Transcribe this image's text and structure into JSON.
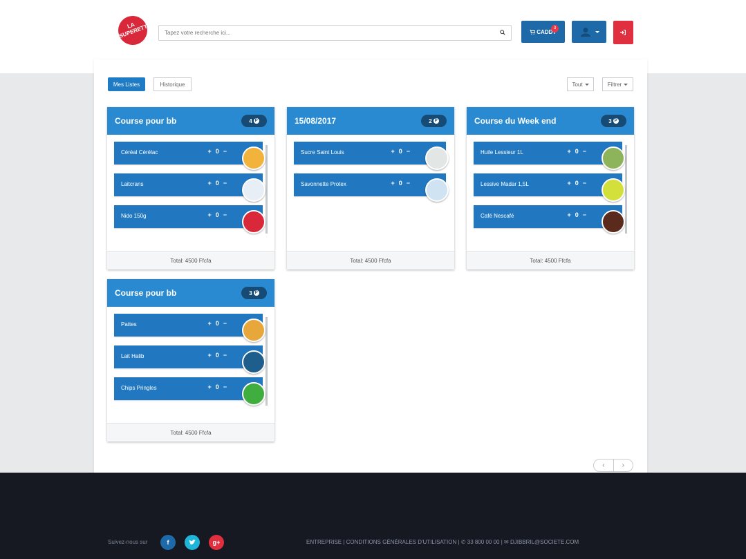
{
  "header": {
    "logo_text": "LA SUPERETTE",
    "search_placeholder": "Tapez votre recherche ici...",
    "caddy_label": "CADDY",
    "caddy_count": "3"
  },
  "tabs": {
    "active": "Mes Listes",
    "inactive": "Historique"
  },
  "filters": {
    "tout": "Tout",
    "filtrer": "Filtrer"
  },
  "lists": [
    {
      "title": "Course pour bb",
      "count": "4",
      "items": [
        {
          "name": "Céréal Cérélac",
          "qty": "0",
          "img_color": "#f2b33d"
        },
        {
          "name": "Laitcrans",
          "qty": "0",
          "img_color": "#e8eef6"
        },
        {
          "name": "Nido 150g",
          "qty": "0",
          "img_color": "#d9283a"
        }
      ],
      "total": "Total: 4500 Ffcfa"
    },
    {
      "title": "15/08/2017",
      "count": "2",
      "items": [
        {
          "name": "Sucre Saint Louis",
          "qty": "0",
          "img_color": "#e2e6e4"
        },
        {
          "name": "Savonnette Protex",
          "qty": "0",
          "img_color": "#cfe3f2"
        }
      ],
      "total": "Total: 4500 Ffcfa"
    },
    {
      "title": "Course du Week end",
      "count": "3",
      "items": [
        {
          "name": "Huile Lessieur 1L",
          "qty": "0",
          "img_color": "#8db45a"
        },
        {
          "name": "Lessive Madar 1,5L",
          "qty": "0",
          "img_color": "#d3df3a"
        },
        {
          "name": "Café Nescafé",
          "qty": "0",
          "img_color": "#5a2a1c"
        }
      ],
      "total": "Total: 4500 Ffcfa"
    },
    {
      "title": "Course pour bb",
      "count": "3",
      "items": [
        {
          "name": "Pattes",
          "qty": "0",
          "img_color": "#e8a73a"
        },
        {
          "name": "Lait Halib",
          "qty": "0",
          "img_color": "#1d5e8c"
        },
        {
          "name": "Chips Pringles",
          "qty": "0",
          "img_color": "#3fae3f"
        }
      ],
      "total": "Total: 4500 Ffcfa"
    }
  ],
  "pager": {
    "prev": "‹",
    "next": "›"
  },
  "footer": {
    "follow": "Suivez-nous sur",
    "entreprise": "ENTREPRISE",
    "cgu": "CONDITIONS GÉNÉRALES D'UTILISATION",
    "phone": "33 800 00 00",
    "email": "DJIBBRIL@SOCIETE.COM"
  },
  "colors": {
    "primary": "#2a8ad1",
    "item": "#2178c0",
    "danger": "#e0303f",
    "footer": "#161822"
  }
}
